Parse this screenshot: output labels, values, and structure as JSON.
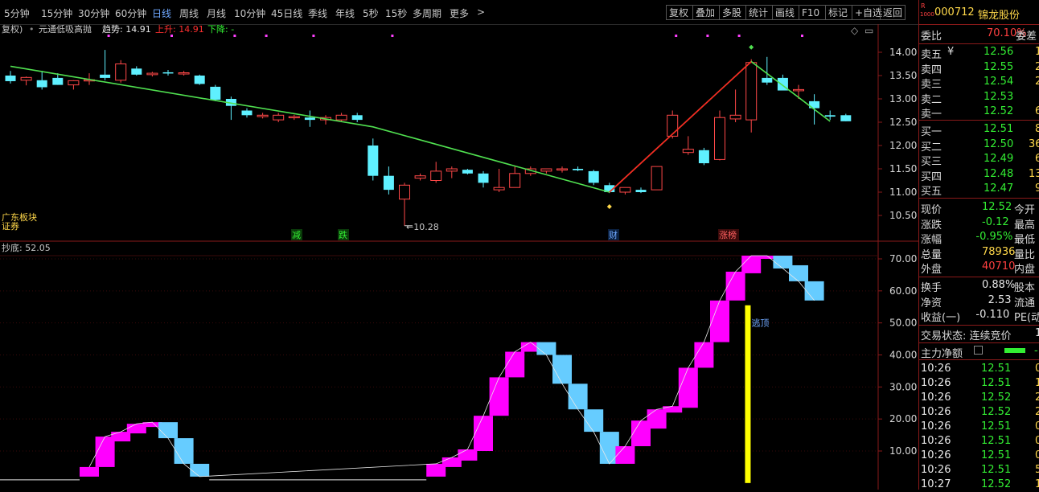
{
  "toolbar": {
    "periods": [
      "5分钟",
      "15分钟",
      "30分钟",
      "60分钟",
      "日线",
      "周线",
      "月线",
      "10分钟",
      "45日线",
      "季线",
      "年线",
      "5秒",
      "15秒",
      "多周期",
      "更多"
    ],
    "active_period": "日线",
    "more_arrow": ">",
    "right_buttons": [
      "复权",
      "叠加",
      "多股",
      "统计",
      "画线",
      "F10",
      "标记",
      "+自选",
      "返回"
    ]
  },
  "indicator_top": {
    "rights_label": "复权)",
    "formula_name": "元通低吸高抛",
    "trend_label": "趋势: 14.91",
    "rise_label": "上升: 14.91",
    "fall_label": "下降: -"
  },
  "indicator_bottom": {
    "name_value": "抄底: 52.05",
    "escape_top_label": "逃顶"
  },
  "annotations": {
    "low_price": "10.28",
    "sector_label_1": "广东板块",
    "sector_label_2": "证券",
    "event_labels": [
      "减",
      "跌",
      "财",
      "涨榜"
    ],
    "collapse_icon": "◇",
    "window_icon": "▭"
  },
  "price_axis": [
    "14.00",
    "13.50",
    "13.00",
    "12.50",
    "12.00",
    "11.50",
    "11.00",
    "10.50"
  ],
  "indicator_axis": [
    "70.00",
    "60.00",
    "50.00",
    "40.00",
    "30.00",
    "20.00",
    "10.00"
  ],
  "colors": {
    "up_candle": "#ff4848",
    "down_candle": "#5ff0ff",
    "trend_line": "#50e050",
    "rise_line": "#ff2020",
    "buy_block": "#ff00ff",
    "sell_block": "#66ccff",
    "escape_bar": "#ffff00"
  },
  "chart_data": {
    "type": "candlestick",
    "candles": [
      {
        "o": 13.5,
        "h": 13.6,
        "l": 13.33,
        "c": 13.38
      },
      {
        "o": 13.4,
        "h": 13.48,
        "l": 13.29,
        "c": 13.46
      },
      {
        "o": 13.4,
        "h": 13.6,
        "l": 13.2,
        "c": 13.25
      },
      {
        "o": 13.45,
        "h": 13.55,
        "l": 13.3,
        "c": 13.3
      },
      {
        "o": 13.3,
        "h": 13.4,
        "l": 13.2,
        "c": 13.39
      },
      {
        "o": 13.4,
        "h": 13.55,
        "l": 13.3,
        "c": 13.41
      },
      {
        "o": 13.52,
        "h": 14.05,
        "l": 13.4,
        "c": 13.45
      },
      {
        "o": 13.4,
        "h": 13.83,
        "l": 13.35,
        "c": 13.75
      },
      {
        "o": 13.65,
        "h": 13.7,
        "l": 13.5,
        "c": 13.52
      },
      {
        "o": 13.52,
        "h": 13.58,
        "l": 13.48,
        "c": 13.55
      },
      {
        "o": 13.57,
        "h": 13.62,
        "l": 13.5,
        "c": 13.55
      },
      {
        "o": 13.55,
        "h": 13.6,
        "l": 13.5,
        "c": 13.56
      },
      {
        "o": 13.5,
        "h": 13.52,
        "l": 13.3,
        "c": 13.32
      },
      {
        "o": 13.26,
        "h": 13.3,
        "l": 12.95,
        "c": 12.98
      },
      {
        "o": 13.0,
        "h": 13.05,
        "l": 12.55,
        "c": 12.85
      },
      {
        "o": 12.75,
        "h": 12.8,
        "l": 12.6,
        "c": 12.65
      },
      {
        "o": 12.62,
        "h": 12.7,
        "l": 12.58,
        "c": 12.65
      },
      {
        "o": 12.55,
        "h": 12.7,
        "l": 12.5,
        "c": 12.65
      },
      {
        "o": 12.6,
        "h": 12.66,
        "l": 12.55,
        "c": 12.62
      },
      {
        "o": 12.6,
        "h": 12.75,
        "l": 12.4,
        "c": 12.55
      },
      {
        "o": 12.55,
        "h": 12.65,
        "l": 12.45,
        "c": 12.6
      },
      {
        "o": 12.55,
        "h": 12.7,
        "l": 12.5,
        "c": 12.65
      },
      {
        "o": 12.65,
        "h": 12.7,
        "l": 12.5,
        "c": 12.55
      },
      {
        "o": 12.0,
        "h": 12.15,
        "l": 11.25,
        "c": 11.35
      },
      {
        "o": 11.35,
        "h": 11.55,
        "l": 10.95,
        "c": 11.05
      },
      {
        "o": 10.85,
        "h": 11.2,
        "l": 10.28,
        "c": 11.15
      },
      {
        "o": 11.3,
        "h": 11.4,
        "l": 11.25,
        "c": 11.35
      },
      {
        "o": 11.25,
        "h": 11.65,
        "l": 11.2,
        "c": 11.45
      },
      {
        "o": 11.45,
        "h": 11.55,
        "l": 11.3,
        "c": 11.5
      },
      {
        "o": 11.48,
        "h": 11.5,
        "l": 11.38,
        "c": 11.4
      },
      {
        "o": 11.4,
        "h": 11.45,
        "l": 11.1,
        "c": 11.2
      },
      {
        "o": 11.05,
        "h": 11.5,
        "l": 11.0,
        "c": 11.1
      },
      {
        "o": 11.1,
        "h": 11.55,
        "l": 11.1,
        "c": 11.4
      },
      {
        "o": 11.4,
        "h": 11.55,
        "l": 11.35,
        "c": 11.5
      },
      {
        "o": 11.45,
        "h": 11.5,
        "l": 11.4,
        "c": 11.5
      },
      {
        "o": 11.48,
        "h": 11.55,
        "l": 11.42,
        "c": 11.5
      },
      {
        "o": 11.5,
        "h": 11.55,
        "l": 11.45,
        "c": 11.47
      },
      {
        "o": 11.45,
        "h": 11.48,
        "l": 11.15,
        "c": 11.2
      },
      {
        "o": 11.15,
        "h": 11.2,
        "l": 10.98,
        "c": 11.0
      },
      {
        "o": 11.0,
        "h": 11.1,
        "l": 10.95,
        "c": 11.1
      },
      {
        "o": 11.05,
        "h": 11.1,
        "l": 10.98,
        "c": 11.0
      },
      {
        "o": 11.05,
        "h": 11.55,
        "l": 11.05,
        "c": 11.55
      },
      {
        "o": 12.2,
        "h": 12.75,
        "l": 12.15,
        "c": 12.65
      },
      {
        "o": 11.85,
        "h": 12.2,
        "l": 11.8,
        "c": 11.92
      },
      {
        "o": 11.9,
        "h": 11.95,
        "l": 11.58,
        "c": 11.62
      },
      {
        "o": 11.7,
        "h": 12.75,
        "l": 11.68,
        "c": 12.6
      },
      {
        "o": 12.57,
        "h": 13.2,
        "l": 12.5,
        "c": 12.65
      },
      {
        "o": 12.55,
        "h": 13.85,
        "l": 12.28,
        "c": 13.78
      },
      {
        "o": 13.45,
        "h": 13.9,
        "l": 13.3,
        "c": 13.35
      },
      {
        "o": 13.45,
        "h": 13.52,
        "l": 13.25,
        "c": 13.18
      },
      {
        "o": 13.2,
        "h": 13.3,
        "l": 13.0,
        "c": 13.2
      },
      {
        "o": 12.95,
        "h": 13.1,
        "l": 12.45,
        "c": 12.8
      },
      {
        "o": 12.65,
        "h": 12.75,
        "l": 12.55,
        "c": 12.62
      },
      {
        "o": 12.65,
        "h": 12.68,
        "l": 12.52,
        "c": 12.52
      }
    ],
    "trend_line": [
      [
        0,
        13.7
      ],
      [
        23,
        12.4
      ],
      [
        38,
        11.0
      ],
      [
        47,
        13.8
      ],
      [
        52,
        12.52
      ]
    ],
    "rise_segment": [
      [
        38,
        11.0
      ],
      [
        47,
        13.8
      ]
    ],
    "low_marker": {
      "index": 25,
      "value": 10.28
    },
    "ylim": [
      10.28,
      14.2
    ],
    "indicator": {
      "blocks": [
        {
          "i": 5,
          "lo": 2.0,
          "hi": 5.0,
          "up": true
        },
        {
          "i": 6,
          "lo": 5.0,
          "hi": 14.5,
          "up": true
        },
        {
          "i": 7,
          "lo": 13.0,
          "hi": 16.0,
          "up": true
        },
        {
          "i": 8,
          "lo": 15.5,
          "hi": 18.5,
          "up": true
        },
        {
          "i": 9,
          "lo": 17.5,
          "hi": 19.0,
          "up": true
        },
        {
          "i": 10,
          "lo": 14.0,
          "hi": 19.0,
          "up": false
        },
        {
          "i": 11,
          "lo": 6.0,
          "hi": 14.0,
          "up": false
        },
        {
          "i": 12,
          "lo": 2.0,
          "hi": 6.0,
          "up": false
        },
        {
          "i": 27,
          "lo": 2.0,
          "hi": 6.0,
          "up": true
        },
        {
          "i": 28,
          "lo": 5.0,
          "hi": 8.0,
          "up": true
        },
        {
          "i": 29,
          "lo": 7.0,
          "hi": 10.5,
          "up": true
        },
        {
          "i": 30,
          "lo": 10.0,
          "hi": 21.0,
          "up": true
        },
        {
          "i": 31,
          "lo": 21.0,
          "hi": 33.0,
          "up": true
        },
        {
          "i": 32,
          "lo": 33.0,
          "hi": 41.0,
          "up": true
        },
        {
          "i": 33,
          "lo": 41.0,
          "hi": 44.0,
          "up": true
        },
        {
          "i": 34,
          "lo": 40.0,
          "hi": 44.0,
          "up": false
        },
        {
          "i": 35,
          "lo": 31.0,
          "hi": 40.0,
          "up": false
        },
        {
          "i": 36,
          "lo": 23.0,
          "hi": 31.0,
          "up": false
        },
        {
          "i": 37,
          "lo": 16.0,
          "hi": 23.0,
          "up": false
        },
        {
          "i": 38,
          "lo": 6.0,
          "hi": 16.0,
          "up": false
        },
        {
          "i": 39,
          "lo": 6.0,
          "hi": 11.5,
          "up": true
        },
        {
          "i": 40,
          "lo": 11.5,
          "hi": 19.5,
          "up": true
        },
        {
          "i": 41,
          "lo": 17.0,
          "hi": 23.0,
          "up": true
        },
        {
          "i": 42,
          "lo": 22.0,
          "hi": 24.0,
          "up": true
        },
        {
          "i": 43,
          "lo": 23.5,
          "hi": 36.0,
          "up": true
        },
        {
          "i": 44,
          "lo": 36.0,
          "hi": 44.0,
          "up": true
        },
        {
          "i": 45,
          "lo": 44.0,
          "hi": 57.0,
          "up": true
        },
        {
          "i": 46,
          "lo": 57.0,
          "hi": 66.0,
          "up": true
        },
        {
          "i": 47,
          "lo": 65.5,
          "hi": 71.0,
          "up": true
        },
        {
          "i": 48,
          "lo": 70.0,
          "hi": 71.0,
          "up": true
        },
        {
          "i": 49,
          "lo": 67.0,
          "hi": 71.0,
          "up": false
        },
        {
          "i": 50,
          "lo": 63.0,
          "hi": 68.0,
          "up": false
        },
        {
          "i": 51,
          "lo": 57.0,
          "hi": 63.0,
          "up": false
        }
      ],
      "escape_bar": {
        "i": 46.4,
        "lo": 0,
        "hi": 55.5
      },
      "ylim": [
        0,
        73
      ]
    }
  },
  "quote": {
    "code_badge_r": "R",
    "code_badge_num": "1000",
    "code": "000712",
    "name": "锦龙股份",
    "wb_label": "委比",
    "wb_value": "70.10%",
    "wc_label": "委差",
    "asks": [
      {
        "label": "卖五",
        "mark": "¥",
        "price": "12.56",
        "vol": "1"
      },
      {
        "label": "卖四",
        "mark": "",
        "price": "12.55",
        "vol": "2"
      },
      {
        "label": "卖三",
        "mark": "",
        "price": "12.54",
        "vol": "2"
      },
      {
        "label": "卖二",
        "mark": "",
        "price": "12.53",
        "vol": ""
      },
      {
        "label": "卖一",
        "mark": "",
        "price": "12.52",
        "vol": "6"
      }
    ],
    "bids": [
      {
        "label": "买一",
        "price": "12.51",
        "vol": "8"
      },
      {
        "label": "买二",
        "price": "12.50",
        "vol": "36"
      },
      {
        "label": "买三",
        "price": "12.49",
        "vol": "6"
      },
      {
        "label": "买四",
        "price": "12.48",
        "vol": "13"
      },
      {
        "label": "买五",
        "price": "12.47",
        "vol": "9"
      }
    ],
    "stats": [
      {
        "label": "现价",
        "value": "12.52",
        "cls": "dn",
        "label2": "今开"
      },
      {
        "label": "涨跌",
        "value": "-0.12",
        "cls": "dn",
        "label2": "最高"
      },
      {
        "label": "涨幅",
        "value": "-0.95%",
        "cls": "dn",
        "label2": "最低"
      },
      {
        "label": "总量",
        "value": "78936",
        "cls": "yel",
        "label2": "量比"
      },
      {
        "label": "外盘",
        "value": "40710",
        "cls": "up",
        "label2": "内盘"
      }
    ],
    "stats2": [
      {
        "label": "换手",
        "value": "0.88%",
        "label2": "股本"
      },
      {
        "label": "净资",
        "value": "2.53",
        "label2": "流通"
      },
      {
        "label": "收益(一)",
        "value": "-0.110",
        "label2": "PE(动"
      }
    ],
    "trade_status": "交易状态: 连续竞价",
    "trade_status_tail": "1",
    "main_net_label": "主力净额",
    "ticks": [
      {
        "time": "10:26",
        "price": "12.51",
        "vol": "0"
      },
      {
        "time": "10:26",
        "price": "12.51",
        "vol": "1"
      },
      {
        "time": "10:26",
        "price": "12.52",
        "vol": "2"
      },
      {
        "time": "10:26",
        "price": "12.52",
        "vol": "2"
      },
      {
        "time": "10:26",
        "price": "12.51",
        "vol": "0"
      },
      {
        "time": "10:26",
        "price": "12.51",
        "vol": "0"
      },
      {
        "time": "10:26",
        "price": "12.51",
        "vol": "0"
      },
      {
        "time": "10:26",
        "price": "12.51",
        "vol": "5"
      },
      {
        "time": "10:27",
        "price": "12.52",
        "vol": "1"
      }
    ]
  }
}
